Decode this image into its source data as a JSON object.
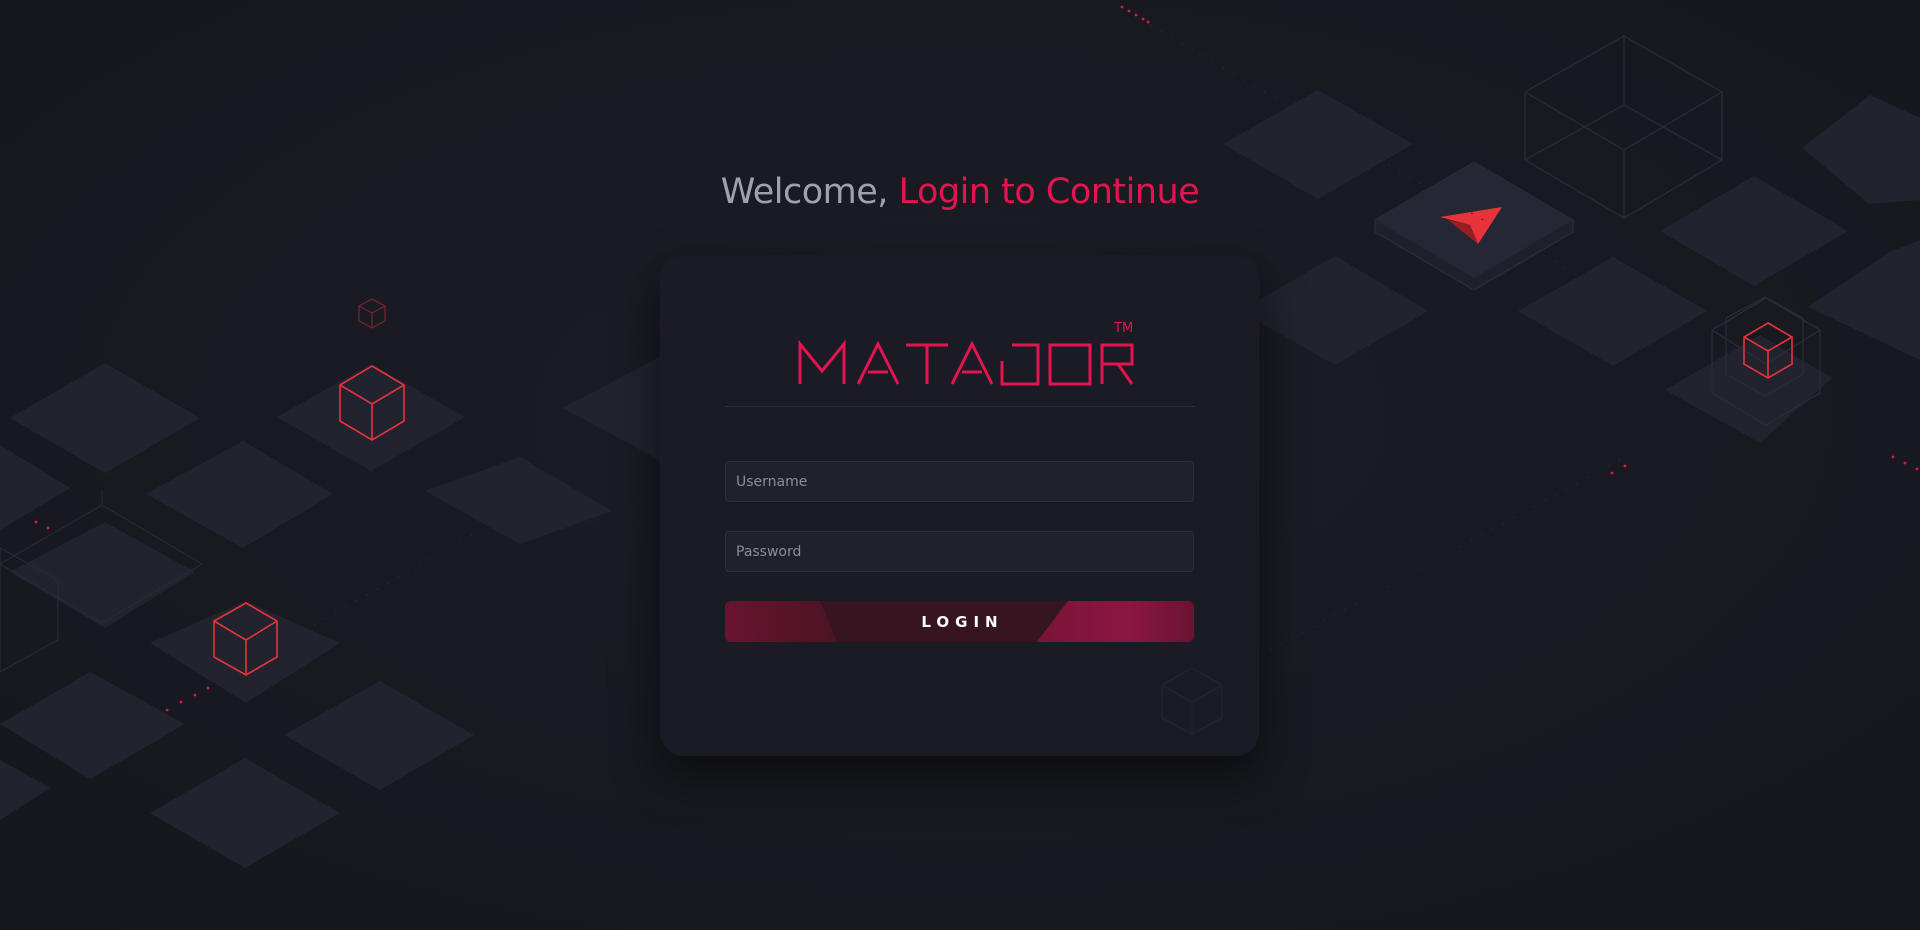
{
  "heading": {
    "welcome": "Welcome,",
    "cta": "Login to Continue"
  },
  "brand": {
    "name": "MATADOR",
    "trademark": "TM",
    "color": "#e3144f"
  },
  "form": {
    "username_placeholder": "Username",
    "password_placeholder": "Password",
    "login_label": "LOGIN"
  },
  "colors": {
    "background": "#181920",
    "card": "#1a1b24",
    "accent": "#e3144f",
    "cube_outline": "#e8333b",
    "welcome_text": "#9da2ab"
  }
}
